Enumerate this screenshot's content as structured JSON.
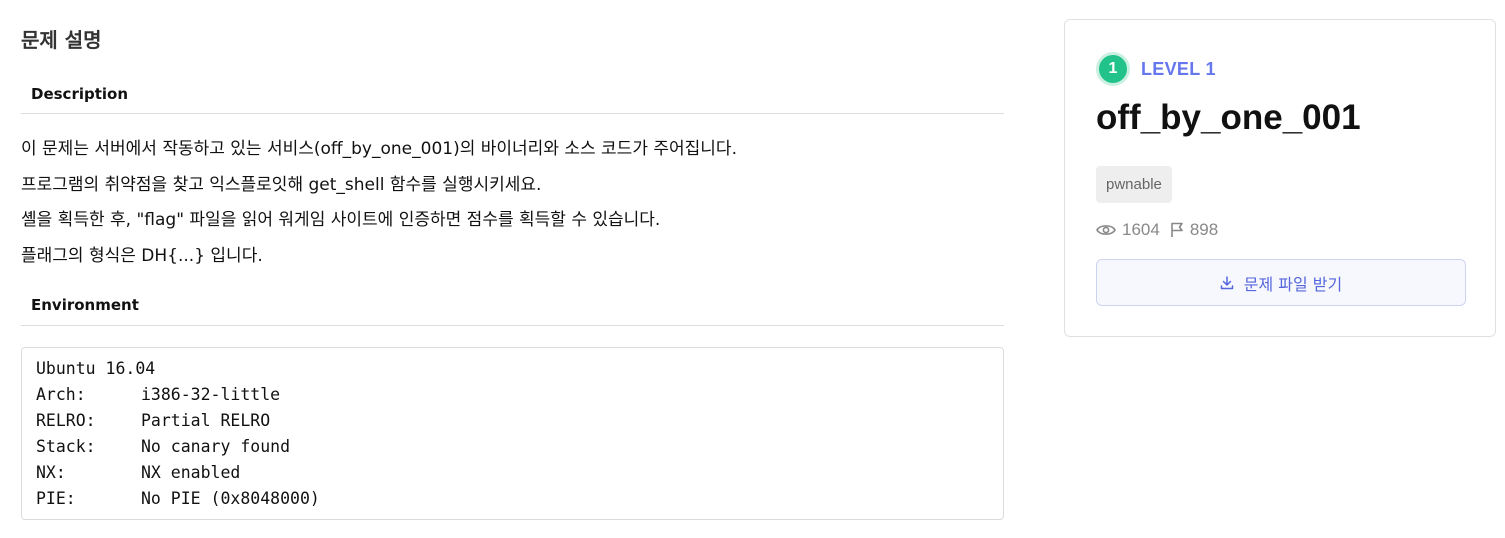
{
  "page_title": "문제 설명",
  "sections": {
    "description_label": "Description",
    "environment_label": "Environment"
  },
  "description": [
    "이 문제는 서버에서 작동하고 있는 서비스(off_by_one_001)의 바이너리와 소스 코드가 주어집니다.",
    "프로그램의 취약점을 찾고 익스플로잇해 get_shell 함수를 실행시키세요.",
    "셸을 획득한 후, \"flag\" 파일을 읽어 워게임 사이트에 인증하면 점수를 획득할 수 있습니다.",
    "플래그의 형식은 DH{...} 입니다."
  ],
  "environment": {
    "os": "Ubuntu 16.04",
    "rows": [
      {
        "key": "Arch:",
        "value": "i386-32-little"
      },
      {
        "key": "RELRO:",
        "value": "Partial RELRO"
      },
      {
        "key": "Stack:",
        "value": "No canary found"
      },
      {
        "key": "NX:",
        "value": "NX enabled"
      },
      {
        "key": "PIE:",
        "value": "No PIE (0x8048000)"
      }
    ]
  },
  "card": {
    "level_number": "1",
    "level_label": "LEVEL 1",
    "title": "off_by_one_001",
    "tag": "pwnable",
    "views": "1604",
    "solves": "898",
    "download_label": "문제 파일 받기",
    "colors": {
      "level_badge": "#22c28b",
      "level_text": "#6677ee",
      "button_text": "#5566dd"
    },
    "icons": {
      "views": "eye-icon",
      "solves": "flag-icon",
      "download": "download-icon"
    }
  }
}
